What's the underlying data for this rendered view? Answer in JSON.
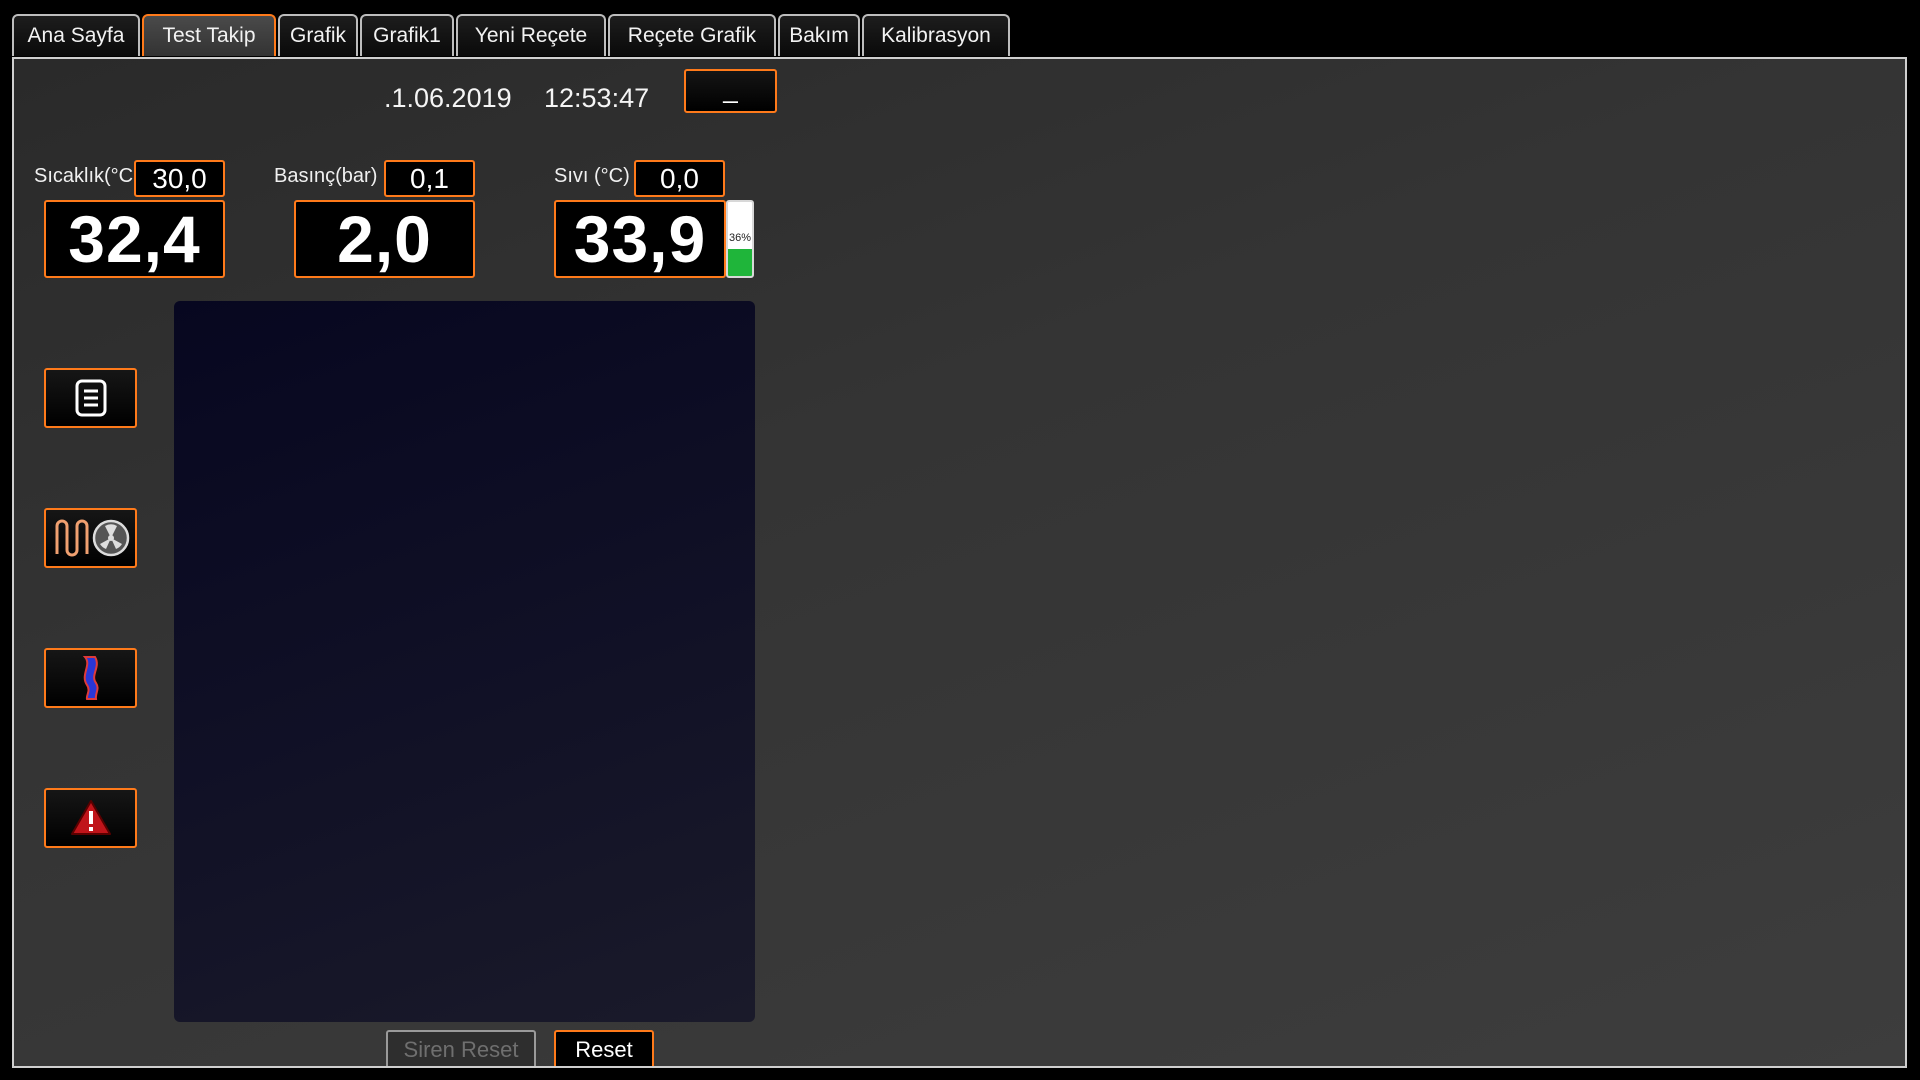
{
  "tabs": [
    {
      "label": "Ana Sayfa"
    },
    {
      "label": "Test Takip"
    },
    {
      "label": "Grafik"
    },
    {
      "label": "Grafik1"
    },
    {
      "label": "Yeni Reçete"
    },
    {
      "label": "Reçete Grafik"
    },
    {
      "label": "Bakım"
    },
    {
      "label": "Kalibrasyon"
    }
  ],
  "active_tab": "Test Takip",
  "header": {
    "date": ".1.06.2019",
    "time": "12:53:47",
    "minimize_label": "_"
  },
  "readings": {
    "temperature": {
      "label": "Sıcaklık(°C",
      "setpoint": "30,0",
      "value": "32,4"
    },
    "pressure": {
      "label": "Basınç(bar)",
      "setpoint": "0,1",
      "value": "2,0"
    },
    "liquid": {
      "label": "Sıvı (°C)",
      "setpoint": "0,0",
      "value": "33,9"
    }
  },
  "level": {
    "text": "36%",
    "percent": 36,
    "color": "#1fb53a"
  },
  "side_buttons": [
    "document-icon",
    "heater-fan-icon",
    "liquid-pipe-icon",
    "alarm-warning-icon"
  ],
  "bottom_buttons": {
    "siren_reset": "Siren Reset",
    "reset": "Reset"
  },
  "colors": {
    "accent": "#ff7a1a",
    "panel": "#333333"
  }
}
